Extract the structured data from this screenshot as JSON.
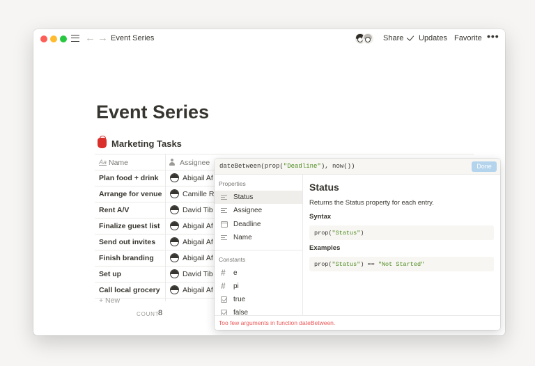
{
  "titlebar": {
    "breadcrumb": "Event Series",
    "share": "Share",
    "updates": "Updates",
    "favorite": "Favorite",
    "more": "•••"
  },
  "page": {
    "title": "Event Series",
    "database_title": "Marketing Tasks"
  },
  "table": {
    "headers": {
      "name": "Name",
      "assignee": "Assignee"
    },
    "rows": [
      {
        "name": "Plan food + drink",
        "assignee": "Abigail Af"
      },
      {
        "name": "Arrange for venue",
        "assignee": "Camille R"
      },
      {
        "name": "Rent A/V",
        "assignee": "David Tib"
      },
      {
        "name": "Finalize guest list",
        "assignee": "Abigail Af"
      },
      {
        "name": "Send out invites",
        "assignee": "Abigail Af"
      },
      {
        "name": "Finish branding",
        "assignee": "Abigail Af"
      },
      {
        "name": "Set up",
        "assignee": "David Tib"
      },
      {
        "name": "Call local grocery",
        "assignee": "Abigail Af"
      }
    ],
    "new_label": "+ New",
    "count_label": "COUNT",
    "count_value": "8"
  },
  "formula": {
    "expression_parts": [
      "dateBetween(prop(",
      "\"Deadline\"",
      "), now())"
    ],
    "done_label": "Done",
    "properties_label": "Properties",
    "properties": [
      "Status",
      "Assignee",
      "Deadline",
      "Name"
    ],
    "constants_label": "Constants",
    "constants": [
      "e",
      "pi",
      "true",
      "false"
    ],
    "doc": {
      "title": "Status",
      "description": "Returns the Status property for each entry.",
      "syntax_label": "Syntax",
      "syntax_parts": [
        "prop(",
        "\"Status\"",
        ")"
      ],
      "examples_label": "Examples",
      "example_parts": [
        "prop(",
        "\"Status\"",
        ") == ",
        "\"Not Started\""
      ]
    },
    "error": "Too few arguments in function dateBetween."
  },
  "colors": {
    "string_green": "#4d8a1d",
    "error_red": "#eb5757",
    "done_blue": "#b3d4ec",
    "text": "#37352f"
  }
}
